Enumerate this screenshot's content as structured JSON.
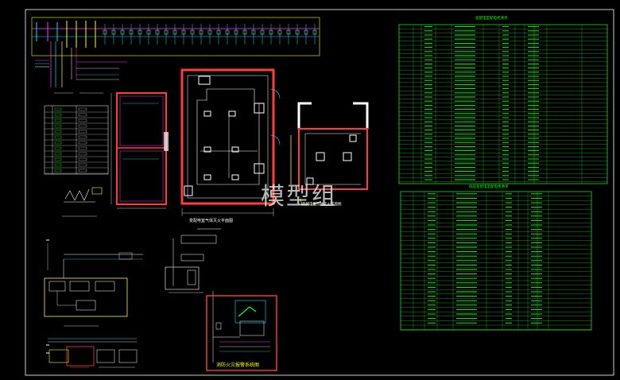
{
  "watermark": "模型组",
  "colors": {
    "background": "#000000",
    "frame": "#ffffff",
    "table": "#18ff18",
    "wall": "#ff3b3b",
    "cyan": "#00e5ff",
    "yellow": "#ffff00",
    "magenta": "#ff33ff",
    "green_dim": "#00b400"
  },
  "labels": {
    "plan_center_title": "变配电室气体灭火平面图",
    "plan_right_title": "变配电室气体灭火平面图",
    "fire_alarm_title": "消防火灾报警系统图"
  },
  "tables": {
    "top_title": "变配电室配电柜清单",
    "bottom_title": "低压变配电室配电柜清单"
  }
}
